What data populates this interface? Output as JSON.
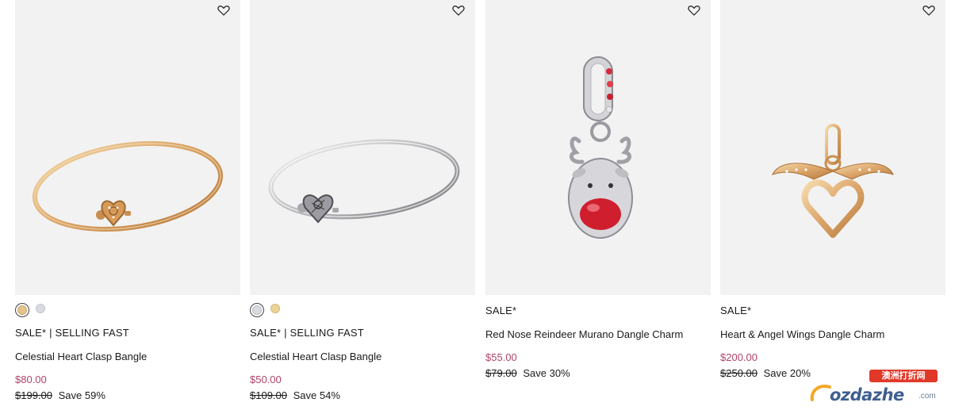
{
  "products": [
    {
      "badge": "SALE* | SELLING FAST",
      "name": "Celestial Heart Clasp Bangle",
      "price": "$80.00",
      "was_price": "$199.00",
      "save": "Save 59%",
      "swatches": [
        {
          "color": "#e3c48e",
          "selected": true
        },
        {
          "color": "#d9dbe0",
          "selected": false
        }
      ]
    },
    {
      "badge": "SALE* | SELLING FAST",
      "name": "Celestial Heart Clasp Bangle",
      "price": "$50.00",
      "was_price": "$109.00",
      "save": "Save 54%",
      "swatches": [
        {
          "color": "#d9dbe0",
          "selected": true
        },
        {
          "color": "#ecd39a",
          "selected": false
        }
      ]
    },
    {
      "badge": "SALE*",
      "name": "Red Nose Reindeer Murano Dangle Charm",
      "price": "$55.00",
      "was_price": "$79.00",
      "save": "Save 30%"
    },
    {
      "badge": "SALE*",
      "name": "Heart & Angel Wings Dangle Charm",
      "price": "$200.00",
      "was_price": "$250.00",
      "save": "Save 20%"
    }
  ],
  "icons": {
    "wishlist": "heart-outline-icon"
  },
  "colors": {
    "sale_price": "#b1436b",
    "image_bg": "#f2f2f2"
  },
  "watermark": {
    "badge": "澳洲打折网",
    "text": "ozdazhe",
    "suffix": ".com"
  }
}
